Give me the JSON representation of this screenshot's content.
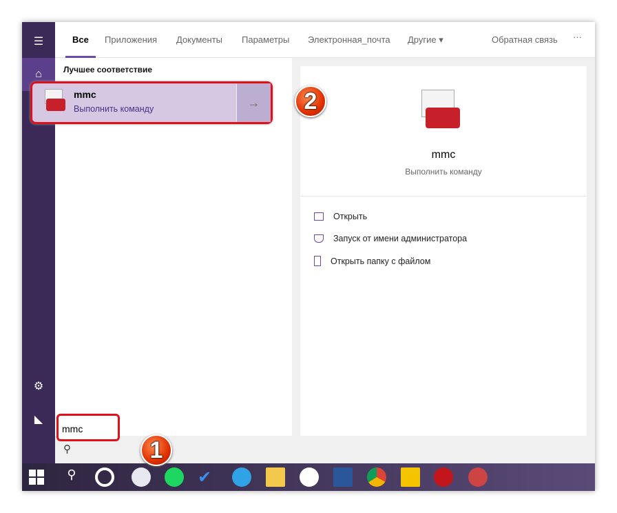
{
  "tabs": [
    "Все",
    "Приложения",
    "Документы",
    "Параметры",
    "Электронная_почта",
    "Другие"
  ],
  "feedback": "Обратная связь",
  "more": "···",
  "best_match": {
    "heading": "Лучшее соответствие",
    "name": "mmc",
    "subtitle": "Выполнить команду"
  },
  "preview": {
    "name": "mmc",
    "subtitle": "Выполнить команду"
  },
  "actions": [
    "Открыть",
    "Запуск от имени администратора",
    "Открыть папку с файлом"
  ],
  "search": {
    "value": "mmc"
  },
  "badges": [
    "1",
    "2"
  ],
  "colors": {
    "accent": "#6b4aa8",
    "sidebar": "#3b2a58",
    "highlight": "#e0101a"
  },
  "taskbar_icons": [
    "start",
    "search",
    "cortana-app",
    "itunes",
    "spotify",
    "todo",
    "telegram",
    "file-explorer",
    "yandex-browser",
    "word",
    "chrome",
    "app-yellow",
    "lastfm",
    "app-red"
  ]
}
